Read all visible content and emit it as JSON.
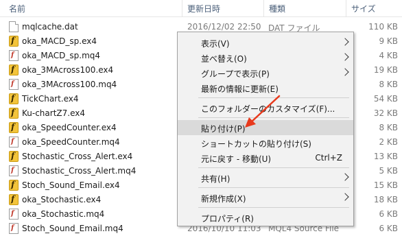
{
  "header": {
    "name": "名前",
    "date": "更新日時",
    "type": "種類",
    "size": "サイズ"
  },
  "files": [
    {
      "name": "mqlcache.dat",
      "icon": "dat-file-icon",
      "date": "2016/12/02 22:50",
      "type": "DAT ファイル",
      "size": "110 KB"
    },
    {
      "name": "oka_MACD_sp.ex4",
      "icon": "ex4-file-icon",
      "date": "",
      "type": "",
      "size": "9 KB"
    },
    {
      "name": "oka_MACD_sp.mq4",
      "icon": "mq4-file-icon",
      "date": "",
      "type": "",
      "size": "4 KB"
    },
    {
      "name": "oka_3MAcross100.ex4",
      "icon": "ex4-file-icon",
      "date": "",
      "type": "",
      "size": "19 KB"
    },
    {
      "name": "oka_3MAcross100.mq4",
      "icon": "mq4-file-icon",
      "date": "",
      "type": "",
      "size": "8 KB"
    },
    {
      "name": "TickChart.ex4",
      "icon": "ex4-file-icon",
      "date": "",
      "type": "",
      "size": "54 KB"
    },
    {
      "name": "Ku-chartZ7.ex4",
      "icon": "ex4-file-icon",
      "date": "",
      "type": "",
      "size": "32 KB"
    },
    {
      "name": "oka_SpeedCounter.ex4",
      "icon": "ex4-file-icon",
      "date": "",
      "type": "",
      "size": "8 KB"
    },
    {
      "name": "oka_SpeedCounter.mq4",
      "icon": "mq4-file-icon",
      "date": "",
      "type": "",
      "size": "2 KB"
    },
    {
      "name": "Stochastic_Cross_Alert.ex4",
      "icon": "ex4-file-icon",
      "date": "",
      "type": "",
      "size": "13 KB"
    },
    {
      "name": "Stochastic_Cross_Alert.mq4",
      "icon": "mq4-file-icon",
      "date": "",
      "type": "",
      "size": "5 KB"
    },
    {
      "name": "Stoch_Sound_Email.ex4",
      "icon": "ex4-file-icon",
      "date": "",
      "type": "",
      "size": "15 KB"
    },
    {
      "name": "oka_Stochastic.ex4",
      "icon": "ex4-file-icon",
      "date": "",
      "type": "",
      "size": "18 KB"
    },
    {
      "name": "oka_Stochastic.mq4",
      "icon": "mq4-file-icon",
      "date": "",
      "type": "",
      "size": "6 KB"
    },
    {
      "name": "Stoch_Sound_Email.mq4",
      "icon": "mq4-file-icon",
      "date": "2016/10/10 11:03",
      "type": "MQL4 Source File",
      "size": "6 KB"
    }
  ],
  "context_menu": {
    "items": [
      {
        "label": "表示(V)",
        "submenu": true
      },
      {
        "label": "並べ替え(O)",
        "submenu": true
      },
      {
        "label": "グループで表示(P)",
        "submenu": true
      },
      {
        "label": "最新の情報に更新(E)"
      },
      {
        "separator": true
      },
      {
        "label": "このフォルダーのカスタマイズ(F)..."
      },
      {
        "separator": true
      },
      {
        "label": "貼り付け(P)",
        "highlighted": true
      },
      {
        "label": "ショートカットの貼り付け(S)"
      },
      {
        "label": "元に戻す - 移動(U)",
        "shortcut": "Ctrl+Z"
      },
      {
        "separator": true
      },
      {
        "label": "共有(H)",
        "submenu": true
      },
      {
        "separator": true
      },
      {
        "label": "新規作成(X)",
        "submenu": true
      },
      {
        "separator": true
      },
      {
        "label": "プロパティ(R)"
      }
    ]
  },
  "colors": {
    "annotation_arrow": "#e8391c",
    "menu_highlight": "#dadada",
    "menu_background": "#f2f2f2"
  }
}
